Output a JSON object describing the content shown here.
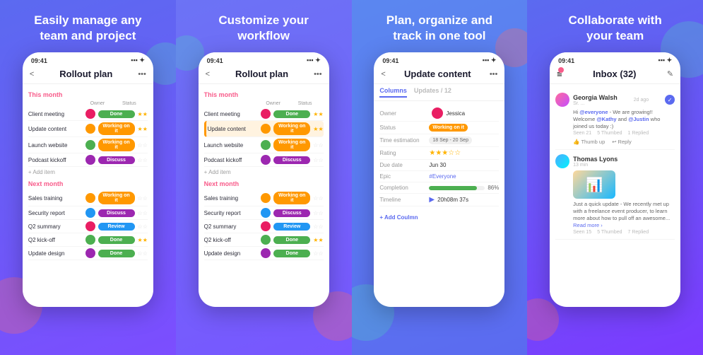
{
  "panels": [
    {
      "id": "panel-1",
      "heading": "Easily manage any\nteam and project",
      "phone": {
        "time": "09:41",
        "title": "Rollout plan",
        "thisMonth": "This month",
        "nextMonth": "Next month",
        "colOwner": "Owner",
        "colStatus": "Status",
        "addItem": "+ Add item",
        "tasks_this": [
          {
            "name": "Client meeting",
            "avatar_bg": "#e91e63",
            "status": "Done",
            "status_class": "status-done",
            "stars": "★★"
          },
          {
            "name": "Update content",
            "avatar_bg": "#ff9800",
            "status": "Working on it",
            "status_class": "status-working",
            "stars": "★★"
          },
          {
            "name": "Launch website",
            "avatar_bg": "#4caf50",
            "status": "Working on it",
            "status_class": "status-working",
            "stars": "☆☆"
          },
          {
            "name": "Podcast kickoff",
            "avatar_bg": "#9c27b0",
            "status": "Discuss",
            "status_class": "status-discuss",
            "stars": "☆☆"
          }
        ],
        "tasks_next": [
          {
            "name": "Sales training",
            "avatar_bg": "#ff9800",
            "status": "Working on it",
            "status_class": "status-working",
            "stars": "☆☆"
          },
          {
            "name": "Security report",
            "avatar_bg": "#2196f3",
            "status": "Discuss",
            "status_class": "status-discuss",
            "stars": "☆☆"
          },
          {
            "name": "Q2 summary",
            "avatar_bg": "#e91e63",
            "status": "Review",
            "status_class": "status-review",
            "stars": "☆☆"
          },
          {
            "name": "Q2 kick-off",
            "avatar_bg": "#4caf50",
            "status": "Done",
            "status_class": "status-done",
            "stars": "★★"
          },
          {
            "name": "Update design",
            "avatar_bg": "#9c27b0",
            "status": "Done",
            "status_class": "status-done",
            "stars": "☆☆"
          }
        ]
      }
    },
    {
      "id": "panel-2",
      "heading": "Customize your\nworkflow",
      "phone": {
        "time": "09:41",
        "title": "Rollout plan",
        "thisMonth": "This month",
        "nextMonth": "Next month",
        "colOwner": "Owner",
        "colStatus": "Status",
        "addItem": "+ Add item",
        "highlighted": "Update content",
        "tasks_this": [
          {
            "name": "Client meeting",
            "avatar_bg": "#e91e63",
            "status": "Done",
            "status_class": "status-done",
            "stars": "★★"
          },
          {
            "name": "Update content",
            "avatar_bg": "#ff9800",
            "status": "Working on it",
            "status_class": "status-working",
            "stars": "★★",
            "highlight": true
          },
          {
            "name": "Launch website",
            "avatar_bg": "#4caf50",
            "status": "Working on it",
            "status_class": "status-working",
            "stars": "☆☆"
          },
          {
            "name": "Podcast kickoff",
            "avatar_bg": "#9c27b0",
            "status": "Discuss",
            "status_class": "status-discuss",
            "stars": "☆☆"
          }
        ],
        "tasks_next": [
          {
            "name": "Sales training",
            "avatar_bg": "#ff9800",
            "status": "Working on it",
            "status_class": "status-working",
            "stars": "☆☆"
          },
          {
            "name": "Security report",
            "avatar_bg": "#2196f3",
            "status": "Discuss",
            "status_class": "status-discuss",
            "stars": "☆☆"
          },
          {
            "name": "Q2 summary",
            "avatar_bg": "#e91e63",
            "status": "Review",
            "status_class": "status-review",
            "stars": "☆☆"
          },
          {
            "name": "Q2 kick-off",
            "avatar_bg": "#4caf50",
            "status": "Done",
            "status_class": "status-done",
            "stars": "★★"
          },
          {
            "name": "Update design",
            "avatar_bg": "#9c27b0",
            "status": "Done",
            "status_class": "status-done",
            "stars": "☆☆"
          }
        ]
      }
    },
    {
      "id": "panel-3",
      "heading": "Plan, organize and\ntrack in one tool",
      "phone": {
        "time": "09:41",
        "title": "Update content",
        "tabs": [
          "Columns",
          "Updates / 12"
        ],
        "activeTab": 0,
        "fields": [
          {
            "label": "Owner",
            "value": "Jessica",
            "type": "avatar",
            "avatar_bg": "#e91e63"
          },
          {
            "label": "Status",
            "value": "Working on it",
            "type": "badge",
            "badge_class": "status-working"
          },
          {
            "label": "Time estimation",
            "value": "18 Sep - 20 Sep",
            "type": "date-range"
          },
          {
            "label": "Rating",
            "value": "★★★☆☆",
            "type": "stars"
          },
          {
            "label": "Due date",
            "value": "Jun 30",
            "type": "text"
          },
          {
            "label": "Epic",
            "value": "#Everyone",
            "type": "hashtag"
          },
          {
            "label": "Completion",
            "value": "86%",
            "type": "progress"
          },
          {
            "label": "Timeline",
            "value": "20h08m37s",
            "type": "timeline"
          }
        ],
        "addColumn": "+ Add Coulmn"
      }
    },
    {
      "id": "panel-4",
      "heading": "Collaborate with\nyour team",
      "phone": {
        "time": "09:41",
        "title": "Inbox (32)",
        "messages": [
          {
            "name": "Georgia Walsh",
            "role": "Sr. ...",
            "time": "2d ago",
            "text": "Hi @everyone - We are growing!! Welcome @Kathy and @Justin who joined us today :)",
            "seen": "Seen 21  5 Thumbed  1 Replied",
            "actions": [
              "Thumb up",
              "Reply"
            ],
            "checked": true
          },
          {
            "name": "Thomas Lyons",
            "role": "13 min",
            "time": "",
            "text": "Just a quick update - We recently met up with a freelance event producer, to learn more about how to pull off an awesome...",
            "seen": "Seen 15  5 Thumbed  7 Replied",
            "actions": [],
            "checked": false,
            "hasImage": true
          }
        ]
      }
    }
  ]
}
